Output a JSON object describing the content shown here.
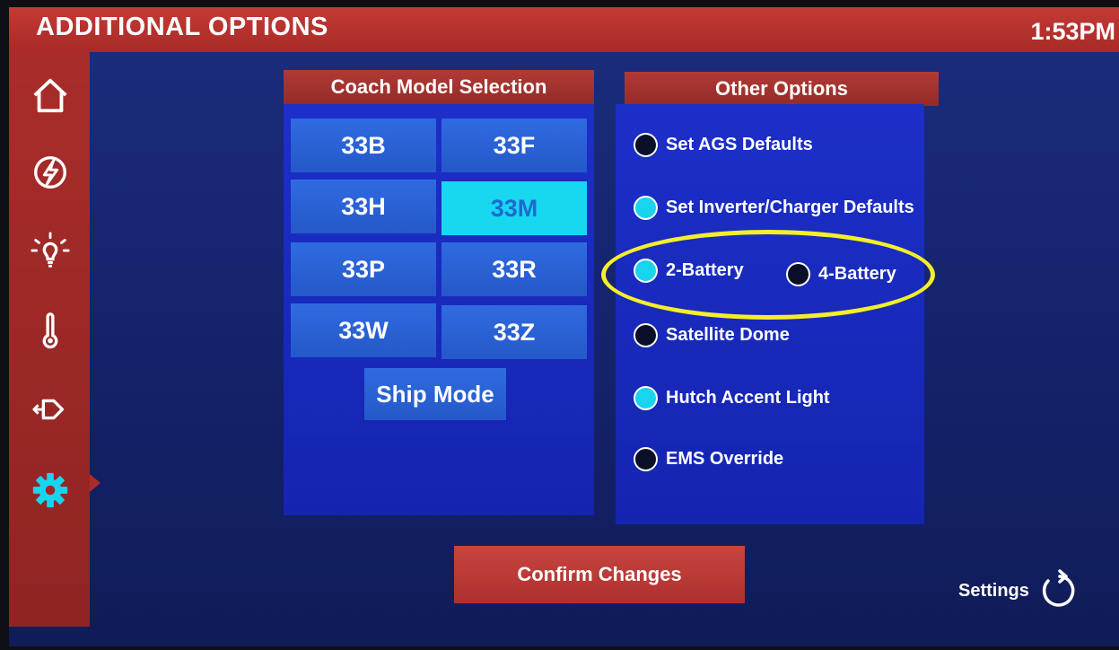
{
  "header": {
    "title": "ADDITIONAL OPTIONS",
    "time": "1:53PM"
  },
  "sidebar": {
    "items": [
      {
        "icon": "home-icon"
      },
      {
        "icon": "power-icon"
      },
      {
        "icon": "light-bulb-icon"
      },
      {
        "icon": "thermometer-icon"
      },
      {
        "icon": "slide-out-icon"
      },
      {
        "icon": "gear-icon",
        "active": true
      }
    ]
  },
  "coach_model": {
    "title": "Coach Model Selection",
    "models": [
      "33B",
      "33F",
      "33H",
      "33M",
      "33P",
      "33R",
      "33W",
      "33Z"
    ],
    "selected": "33M",
    "ship_mode_label": "Ship Mode"
  },
  "other_options": {
    "title": "Other Options",
    "set_ags": {
      "label": "Set AGS Defaults",
      "checked": false
    },
    "set_inverter": {
      "label": "Set Inverter/Charger Defaults",
      "checked": true
    },
    "battery_2": {
      "label": "2-Battery",
      "checked": true
    },
    "battery_4": {
      "label": "4-Battery",
      "checked": false
    },
    "satellite": {
      "label": "Satellite Dome",
      "checked": false
    },
    "hutch": {
      "label": "Hutch Accent Light",
      "checked": true
    },
    "ems": {
      "label": "EMS Override",
      "checked": false
    }
  },
  "footer": {
    "confirm_label": "Confirm Changes",
    "settings_label": "Settings"
  },
  "colors": {
    "accent_red": "#a82d2a",
    "panel_blue": "#1c2fc8",
    "button_blue": "#2f6be0",
    "selected_cyan": "#18d8f0",
    "highlight_yellow": "#f4ef2a"
  }
}
